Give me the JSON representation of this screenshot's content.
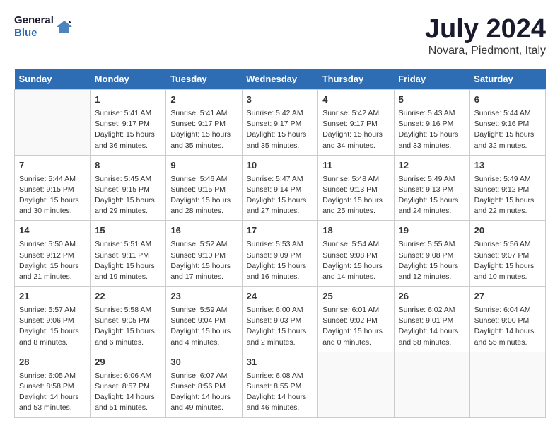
{
  "logo": {
    "line1": "General",
    "line2": "Blue"
  },
  "title": "July 2024",
  "subtitle": "Novara, Piedmont, Italy",
  "weekdays": [
    "Sunday",
    "Monday",
    "Tuesday",
    "Wednesday",
    "Thursday",
    "Friday",
    "Saturday"
  ],
  "weeks": [
    [
      {
        "day": "",
        "info": ""
      },
      {
        "day": "1",
        "info": "Sunrise: 5:41 AM\nSunset: 9:17 PM\nDaylight: 15 hours\nand 36 minutes."
      },
      {
        "day": "2",
        "info": "Sunrise: 5:41 AM\nSunset: 9:17 PM\nDaylight: 15 hours\nand 35 minutes."
      },
      {
        "day": "3",
        "info": "Sunrise: 5:42 AM\nSunset: 9:17 PM\nDaylight: 15 hours\nand 35 minutes."
      },
      {
        "day": "4",
        "info": "Sunrise: 5:42 AM\nSunset: 9:17 PM\nDaylight: 15 hours\nand 34 minutes."
      },
      {
        "day": "5",
        "info": "Sunrise: 5:43 AM\nSunset: 9:16 PM\nDaylight: 15 hours\nand 33 minutes."
      },
      {
        "day": "6",
        "info": "Sunrise: 5:44 AM\nSunset: 9:16 PM\nDaylight: 15 hours\nand 32 minutes."
      }
    ],
    [
      {
        "day": "7",
        "info": "Sunrise: 5:44 AM\nSunset: 9:15 PM\nDaylight: 15 hours\nand 30 minutes."
      },
      {
        "day": "8",
        "info": "Sunrise: 5:45 AM\nSunset: 9:15 PM\nDaylight: 15 hours\nand 29 minutes."
      },
      {
        "day": "9",
        "info": "Sunrise: 5:46 AM\nSunset: 9:15 PM\nDaylight: 15 hours\nand 28 minutes."
      },
      {
        "day": "10",
        "info": "Sunrise: 5:47 AM\nSunset: 9:14 PM\nDaylight: 15 hours\nand 27 minutes."
      },
      {
        "day": "11",
        "info": "Sunrise: 5:48 AM\nSunset: 9:13 PM\nDaylight: 15 hours\nand 25 minutes."
      },
      {
        "day": "12",
        "info": "Sunrise: 5:49 AM\nSunset: 9:13 PM\nDaylight: 15 hours\nand 24 minutes."
      },
      {
        "day": "13",
        "info": "Sunrise: 5:49 AM\nSunset: 9:12 PM\nDaylight: 15 hours\nand 22 minutes."
      }
    ],
    [
      {
        "day": "14",
        "info": "Sunrise: 5:50 AM\nSunset: 9:12 PM\nDaylight: 15 hours\nand 21 minutes."
      },
      {
        "day": "15",
        "info": "Sunrise: 5:51 AM\nSunset: 9:11 PM\nDaylight: 15 hours\nand 19 minutes."
      },
      {
        "day": "16",
        "info": "Sunrise: 5:52 AM\nSunset: 9:10 PM\nDaylight: 15 hours\nand 17 minutes."
      },
      {
        "day": "17",
        "info": "Sunrise: 5:53 AM\nSunset: 9:09 PM\nDaylight: 15 hours\nand 16 minutes."
      },
      {
        "day": "18",
        "info": "Sunrise: 5:54 AM\nSunset: 9:08 PM\nDaylight: 15 hours\nand 14 minutes."
      },
      {
        "day": "19",
        "info": "Sunrise: 5:55 AM\nSunset: 9:08 PM\nDaylight: 15 hours\nand 12 minutes."
      },
      {
        "day": "20",
        "info": "Sunrise: 5:56 AM\nSunset: 9:07 PM\nDaylight: 15 hours\nand 10 minutes."
      }
    ],
    [
      {
        "day": "21",
        "info": "Sunrise: 5:57 AM\nSunset: 9:06 PM\nDaylight: 15 hours\nand 8 minutes."
      },
      {
        "day": "22",
        "info": "Sunrise: 5:58 AM\nSunset: 9:05 PM\nDaylight: 15 hours\nand 6 minutes."
      },
      {
        "day": "23",
        "info": "Sunrise: 5:59 AM\nSunset: 9:04 PM\nDaylight: 15 hours\nand 4 minutes."
      },
      {
        "day": "24",
        "info": "Sunrise: 6:00 AM\nSunset: 9:03 PM\nDaylight: 15 hours\nand 2 minutes."
      },
      {
        "day": "25",
        "info": "Sunrise: 6:01 AM\nSunset: 9:02 PM\nDaylight: 15 hours\nand 0 minutes."
      },
      {
        "day": "26",
        "info": "Sunrise: 6:02 AM\nSunset: 9:01 PM\nDaylight: 14 hours\nand 58 minutes."
      },
      {
        "day": "27",
        "info": "Sunrise: 6:04 AM\nSunset: 9:00 PM\nDaylight: 14 hours\nand 55 minutes."
      }
    ],
    [
      {
        "day": "28",
        "info": "Sunrise: 6:05 AM\nSunset: 8:58 PM\nDaylight: 14 hours\nand 53 minutes."
      },
      {
        "day": "29",
        "info": "Sunrise: 6:06 AM\nSunset: 8:57 PM\nDaylight: 14 hours\nand 51 minutes."
      },
      {
        "day": "30",
        "info": "Sunrise: 6:07 AM\nSunset: 8:56 PM\nDaylight: 14 hours\nand 49 minutes."
      },
      {
        "day": "31",
        "info": "Sunrise: 6:08 AM\nSunset: 8:55 PM\nDaylight: 14 hours\nand 46 minutes."
      },
      {
        "day": "",
        "info": ""
      },
      {
        "day": "",
        "info": ""
      },
      {
        "day": "",
        "info": ""
      }
    ]
  ]
}
